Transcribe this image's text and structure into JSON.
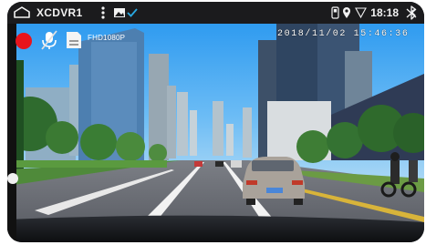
{
  "status_bar": {
    "app_title": "XCDVR1",
    "time": "18:18",
    "icons": [
      "home-icon",
      "more-vertical-icon",
      "gallery-icon",
      "check-icon",
      "storage-icon",
      "location-icon",
      "signal-icon",
      "battery-icon"
    ]
  },
  "overlay": {
    "record_indicator_color": "#e8141c",
    "mic_state": "muted",
    "resolution": "FHD1080P",
    "timestamp": "2018/11/02 15:46:36"
  }
}
